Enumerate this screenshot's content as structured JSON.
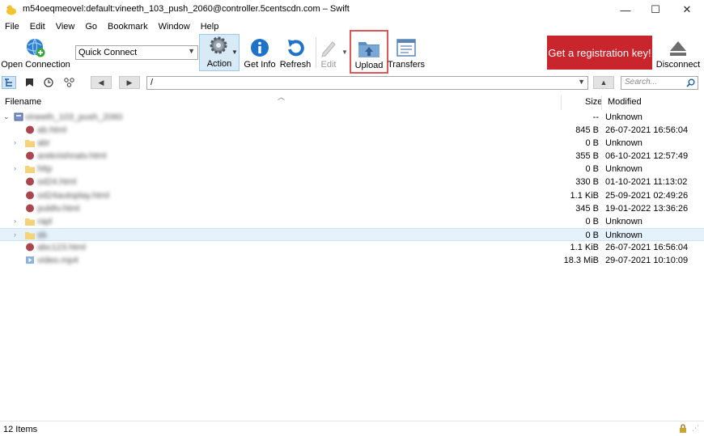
{
  "window": {
    "title": "m54oeqmeovel:default:vineeth_103_push_2060@controller.5centscdn.com – Swift",
    "minimize_glyph": "—",
    "maximize_glyph": "☐",
    "close_glyph": "✕"
  },
  "menu": [
    "File",
    "Edit",
    "View",
    "Go",
    "Bookmark",
    "Window",
    "Help"
  ],
  "toolbar": {
    "open_connection": "Open Connection",
    "quick_connect_value": "Quick Connect",
    "action": "Action",
    "get_info": "Get Info",
    "refresh": "Refresh",
    "edit": "Edit",
    "upload": "Upload",
    "transfers": "Transfers",
    "registration": "Get a registration key!",
    "disconnect": "Disconnect"
  },
  "navbar": {
    "path": "/",
    "search_placeholder": "Search..."
  },
  "columns": {
    "filename": "Filename",
    "size": "Size",
    "modified": "Modified"
  },
  "root": {
    "name": "vineeth_103_push_2060",
    "size": "--",
    "modified": "Unknown"
  },
  "rows": [
    {
      "name": "ab.html",
      "type": "file",
      "expandable": false,
      "size": "845 B",
      "modified": "26-07-2021 16:56:04"
    },
    {
      "name": "abr",
      "type": "folder",
      "expandable": true,
      "size": "0 B",
      "modified": "Unknown"
    },
    {
      "name": "areknishnatv.html",
      "type": "file",
      "expandable": false,
      "size": "355 B",
      "modified": "06-10-2021 12:57:49"
    },
    {
      "name": "http",
      "type": "folder",
      "expandable": true,
      "size": "0 B",
      "modified": "Unknown"
    },
    {
      "name": "od24.html",
      "type": "file",
      "expandable": false,
      "size": "330 B",
      "modified": "01-10-2021 11:13:02"
    },
    {
      "name": "od24autoplay.html",
      "type": "file",
      "expandable": false,
      "size": "1.1 KiB",
      "modified": "25-09-2021 02:49:26"
    },
    {
      "name": "puldtv.html",
      "type": "file",
      "expandable": false,
      "size": "345 B",
      "modified": "19-01-2022 13:36:26"
    },
    {
      "name": "rapl",
      "type": "folder",
      "expandable": true,
      "size": "0 B",
      "modified": "Unknown"
    },
    {
      "name": "sb",
      "type": "folder",
      "expandable": true,
      "size": "0 B",
      "modified": "Unknown",
      "selected": true
    },
    {
      "name": "abc123.html",
      "type": "file",
      "expandable": false,
      "size": "1.1 KiB",
      "modified": "26-07-2021 16:56:04"
    },
    {
      "name": "video.mp4",
      "type": "video",
      "expandable": false,
      "size": "18.3 MiB",
      "modified": "29-07-2021 10:10:09"
    }
  ],
  "status": {
    "text": "12 Items"
  },
  "colors": {
    "registration_bg": "#c9252c",
    "selected_row": "#e5f1fb",
    "highlight_border": "#e05656",
    "folder": "#f4d37a",
    "html_file": "#a9474f"
  }
}
